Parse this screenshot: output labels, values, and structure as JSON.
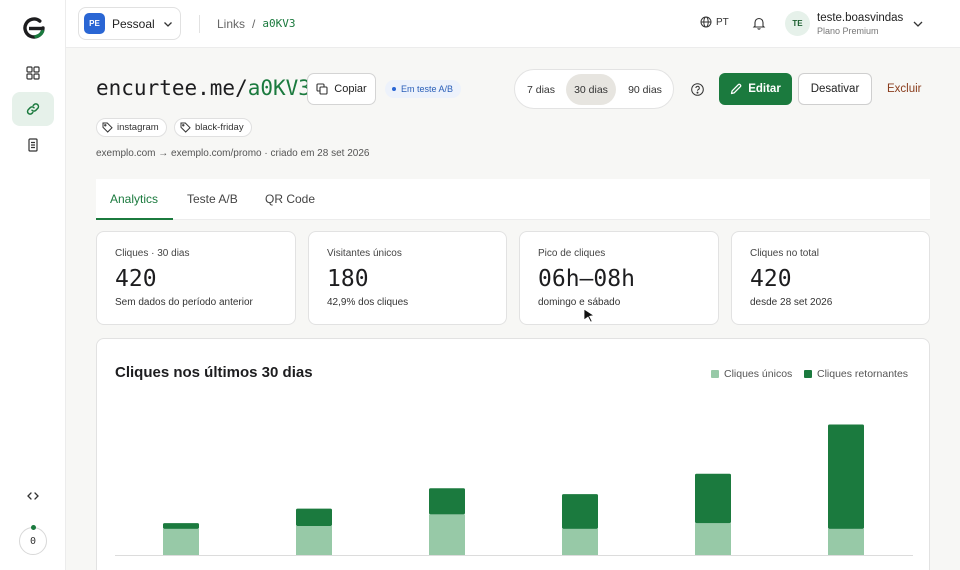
{
  "topbar": {
    "workspace_badge": "PE",
    "workspace_name": "Pessoal",
    "breadcrumb_root": "Links",
    "breadcrumb_separator": "/",
    "breadcrumb_current": "a0KV3",
    "language": "PT",
    "user_initials": "TE",
    "user_name": "teste.boasvindas",
    "user_plan": "Plano Premium"
  },
  "sidebar": {
    "counter": "0",
    "items": [
      "dashboard-icon",
      "link-icon",
      "document-icon",
      "code-icon"
    ]
  },
  "link": {
    "domain": "encurtee.me/",
    "code": "a0KV3",
    "copy_label": "Copiar",
    "ab_badge": "Em teste A/B",
    "tags": [
      "instagram",
      "black-friday"
    ],
    "meta": "exemplo.com → exemplo.com/promo · criado em 28 set 2026"
  },
  "range": {
    "options": [
      "7 dias",
      "30 dias",
      "90 dias"
    ],
    "selected": "30 dias"
  },
  "actions": {
    "edit": "Editar",
    "deactivate": "Desativar",
    "delete": "Excluir"
  },
  "tabs": [
    "Analytics",
    "Teste A/B",
    "QR Code"
  ],
  "active_tab": "Analytics",
  "stats": [
    {
      "label": "Cliques · 30 dias",
      "value": "420",
      "sub": "Sem dados do período anterior"
    },
    {
      "label": "Visitantes únicos",
      "value": "180",
      "sub": "42,9% dos cliques"
    },
    {
      "label": "Pico de cliques",
      "value": "06h–08h",
      "sub": "domingo e sábado"
    },
    {
      "label": "Cliques no total",
      "value": "420",
      "sub": "desde 28 set 2026"
    }
  ],
  "colors": {
    "accent": "#1b7a3e",
    "unique": "#97c9a7",
    "returning": "#1b7a3e"
  },
  "chart_data": {
    "type": "bar",
    "stacked": true,
    "title": "Cliques nos últimos 30 dias",
    "categories": [
      "",
      "",
      "",
      "",
      "",
      ""
    ],
    "series": [
      {
        "name": "Cliques únicos",
        "values": [
          9,
          10,
          14,
          9,
          11,
          9
        ]
      },
      {
        "name": "Cliques retornantes",
        "values": [
          2,
          6,
          9,
          12,
          17,
          36
        ]
      }
    ],
    "legend": "top-right",
    "grid": false
  }
}
